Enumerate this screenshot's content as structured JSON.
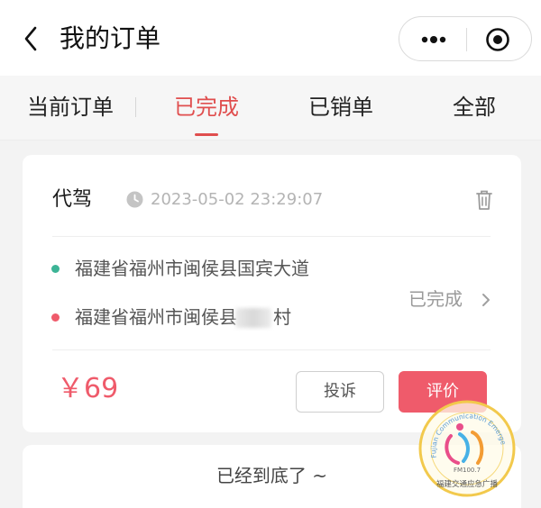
{
  "header": {
    "title": "我的订单",
    "back_icon": "chevron-left-icon",
    "more_icon": "more-dots-icon",
    "close_icon": "target-circle-icon"
  },
  "tabs": [
    {
      "label": "当前订单",
      "active": false
    },
    {
      "label": "已完成",
      "active": true
    },
    {
      "label": "已销单",
      "active": false
    },
    {
      "label": "全部",
      "active": false
    }
  ],
  "order": {
    "service_type": "代驾",
    "time": "2023-05-02 23:29:07",
    "start_address": "福建省福州市闽侯县国宾大道",
    "end_address_prefix": "福建省福州市闽侯县",
    "end_address_suffix": "村",
    "status": "已完成",
    "price": "￥69",
    "complaint_label": "投诉",
    "review_label": "评价"
  },
  "footer": {
    "end_text": "已经到底了 ~"
  },
  "watermark": {
    "arc_text": "Fujian Communication Emergency Radio",
    "frequency": "FM100.7",
    "station_name": "福建交通应急广播"
  },
  "colors": {
    "accent": "#ef5b6b",
    "active_tab": "#e04e4e",
    "start_dot": "#3cb496",
    "end_dot": "#ef5b6b"
  }
}
